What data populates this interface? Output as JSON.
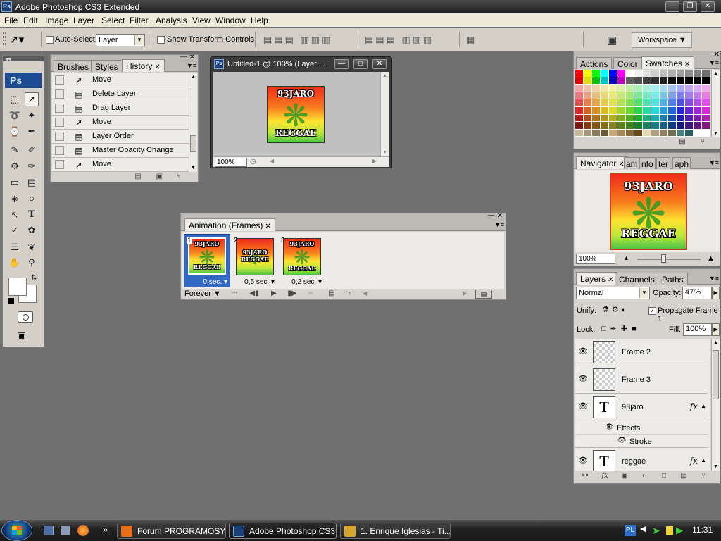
{
  "app": {
    "title": "Adobe Photoshop CS3 Extended",
    "logo": "Ps"
  },
  "menu": [
    "File",
    "Edit",
    "Image",
    "Layer",
    "Select",
    "Filter",
    "Analysis",
    "View",
    "Window",
    "Help"
  ],
  "options_bar": {
    "auto_select_label": "Auto-Select:",
    "auto_select_checked": false,
    "auto_select_value": "Layer",
    "show_transform_label": "Show Transform Controls",
    "show_transform_checked": false,
    "workspace_label": "Workspace"
  },
  "toolbox": {
    "logo": "Ps"
  },
  "history_panel": {
    "tabs": [
      "Brushes",
      "Styles",
      "History"
    ],
    "active_tab": "History",
    "items": [
      "Move",
      "Delete Layer",
      "Drag Layer",
      "Move",
      "Layer Order",
      "Master Opacity Change",
      "Move"
    ]
  },
  "document": {
    "title": "Untitled-1 @ 100% (Layer ...",
    "zoom": "100%",
    "art_text_top": "93JARO",
    "art_text_bottom": "REGGAE"
  },
  "animation_panel": {
    "title": "Animation (Frames)",
    "frames": [
      {
        "num": "1",
        "delay": "0 sec.",
        "selected": true
      },
      {
        "num": "2",
        "delay": "0,5 sec.",
        "selected": false
      },
      {
        "num": "3",
        "delay": "0,2 sec.",
        "selected": false
      }
    ],
    "loop": "Forever"
  },
  "swatches_panel": {
    "tabs": [
      "Actions",
      "Color",
      "Swatches"
    ],
    "active_tab": "Swatches"
  },
  "navigator_panel": {
    "tabs": [
      "Navigator",
      "am",
      "nfo",
      "ter",
      "aph"
    ],
    "active_tab": "Navigator",
    "zoom": "100%"
  },
  "layers_panel": {
    "tabs": [
      "Layers",
      "Channels",
      "Paths"
    ],
    "active_tab": "Layers",
    "blend_mode": "Normal",
    "opacity_label": "Opacity:",
    "opacity": "47%",
    "unify_label": "Unify:",
    "propagate_label": "Propagate Frame 1",
    "propagate_checked": true,
    "lock_label": "Lock:",
    "fill_label": "Fill:",
    "fill": "100%",
    "layers": [
      {
        "name": "Frame 2",
        "type": "image",
        "fx": false
      },
      {
        "name": "Frame 3",
        "type": "image",
        "fx": false
      },
      {
        "name": "93jaro",
        "type": "text",
        "fx": true
      },
      {
        "name": "reggae",
        "type": "text",
        "fx": true
      }
    ],
    "effects_label": "Effects",
    "stroke_label": "Stroke"
  },
  "taskbar": {
    "tasks": [
      {
        "label": "Forum PROGRAMOSY....",
        "active": false,
        "icon_color": "#e8701a"
      },
      {
        "label": "Adobe Photoshop CS3....",
        "active": true,
        "icon_color": "#1c3f78"
      },
      {
        "label": "1. Enrique Iglesias - Ti...",
        "active": false,
        "icon_color": "#d9a531"
      }
    ],
    "clock": "11:31"
  },
  "colors": {
    "accent_blue": "#3168c4",
    "ps_blue": "#1c3f78",
    "canvas_bg": "#707070"
  }
}
